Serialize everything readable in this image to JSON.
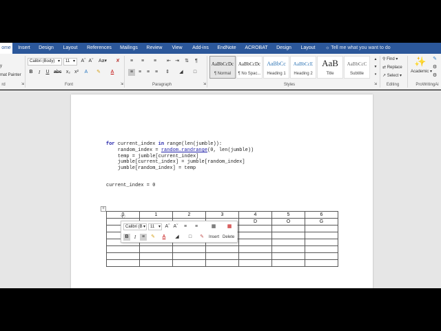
{
  "tabs": [
    {
      "label": "ome",
      "active": true
    },
    {
      "label": "Insert"
    },
    {
      "label": "Design"
    },
    {
      "label": "Layout"
    },
    {
      "label": "References"
    },
    {
      "label": "Mailings"
    },
    {
      "label": "Review"
    },
    {
      "label": "View"
    },
    {
      "label": "Add-ins"
    },
    {
      "label": "EndNote"
    },
    {
      "label": "ACROBAT"
    },
    {
      "label": "Design"
    },
    {
      "label": "Layout"
    }
  ],
  "tell_me": "Tell me what you want to do",
  "clipboard": {
    "copy": "y",
    "format_painter": "mat Painter",
    "label": "rd"
  },
  "font": {
    "name": "Calibri (Body)",
    "size": "11",
    "label": "Font"
  },
  "paragraph": {
    "label": "Paragraph"
  },
  "styles": {
    "label": "Styles",
    "items": [
      {
        "preview": "AaBbCcDc",
        "name": "¶ Normal"
      },
      {
        "preview": "AaBbCcDc",
        "name": "¶ No Spac..."
      },
      {
        "preview": "AaBbCc",
        "name": "Heading 1"
      },
      {
        "preview": "AaBbCcE",
        "name": "Heading 2"
      },
      {
        "preview": "AaB",
        "name": "Title"
      },
      {
        "preview": "AaBbCcC",
        "name": "Subtitle"
      }
    ]
  },
  "editing": {
    "find": "Find",
    "replace": "Replace",
    "select": "Select",
    "label": "Editing"
  },
  "prowriting": {
    "name": "Academic",
    "label": "ProWritingAi"
  },
  "code": {
    "line1_kw": "for",
    "line1_a": " current_index ",
    "line1_kw2": "in",
    "line1_b": " range(len(jumble)):",
    "line2_a": "    random_index = ",
    "line2_link": "random.randrange",
    "line2_b": "(0, len(jumble))",
    "line3": "    temp = jumble[current_index]",
    "line4": "    jumble[current_index] = jumble[random_index]",
    "line5": "    jumble[random_index] = temp",
    "line6": "current_index = 0"
  },
  "table": {
    "rows": [
      [
        "0",
        "1",
        "2",
        "3",
        "4",
        "5",
        "6"
      ],
      [
        "",
        "",
        "",
        "",
        "D",
        "O",
        "G"
      ],
      [
        "",
        "",
        "",
        "",
        "",
        "",
        ""
      ],
      [
        "",
        "",
        "",
        "",
        "",
        "",
        ""
      ],
      [
        "",
        "",
        "",
        "",
        "",
        "",
        ""
      ],
      [
        "",
        "",
        "",
        "",
        "",
        "",
        ""
      ],
      [
        "",
        "",
        "",
        "",
        "",
        "",
        ""
      ],
      [
        "",
        "",
        "",
        "",
        "",
        "",
        ""
      ]
    ]
  },
  "mini_toolbar": {
    "font": "Calibri (B",
    "size": "11",
    "insert": "Insert",
    "delete": "Delete"
  }
}
